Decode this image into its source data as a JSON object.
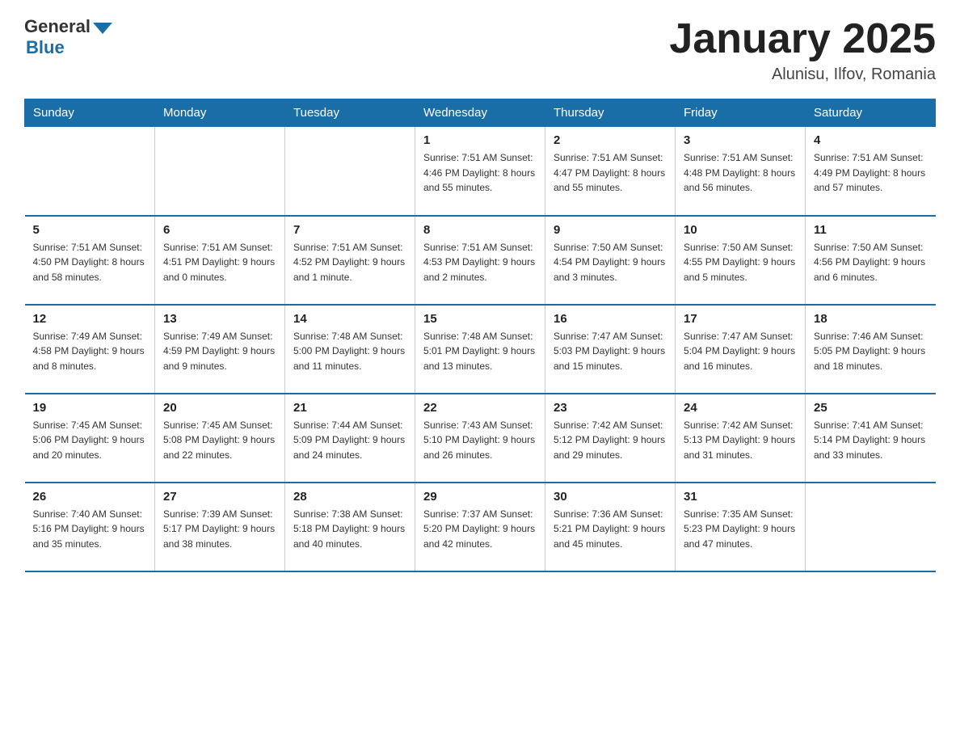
{
  "header": {
    "logo_general": "General",
    "logo_blue": "Blue",
    "main_title": "January 2025",
    "subtitle": "Alunisu, Ilfov, Romania"
  },
  "days_of_week": [
    "Sunday",
    "Monday",
    "Tuesday",
    "Wednesday",
    "Thursday",
    "Friday",
    "Saturday"
  ],
  "weeks": [
    [
      {
        "day": "",
        "info": ""
      },
      {
        "day": "",
        "info": ""
      },
      {
        "day": "",
        "info": ""
      },
      {
        "day": "1",
        "info": "Sunrise: 7:51 AM\nSunset: 4:46 PM\nDaylight: 8 hours\nand 55 minutes."
      },
      {
        "day": "2",
        "info": "Sunrise: 7:51 AM\nSunset: 4:47 PM\nDaylight: 8 hours\nand 55 minutes."
      },
      {
        "day": "3",
        "info": "Sunrise: 7:51 AM\nSunset: 4:48 PM\nDaylight: 8 hours\nand 56 minutes."
      },
      {
        "day": "4",
        "info": "Sunrise: 7:51 AM\nSunset: 4:49 PM\nDaylight: 8 hours\nand 57 minutes."
      }
    ],
    [
      {
        "day": "5",
        "info": "Sunrise: 7:51 AM\nSunset: 4:50 PM\nDaylight: 8 hours\nand 58 minutes."
      },
      {
        "day": "6",
        "info": "Sunrise: 7:51 AM\nSunset: 4:51 PM\nDaylight: 9 hours\nand 0 minutes."
      },
      {
        "day": "7",
        "info": "Sunrise: 7:51 AM\nSunset: 4:52 PM\nDaylight: 9 hours\nand 1 minute."
      },
      {
        "day": "8",
        "info": "Sunrise: 7:51 AM\nSunset: 4:53 PM\nDaylight: 9 hours\nand 2 minutes."
      },
      {
        "day": "9",
        "info": "Sunrise: 7:50 AM\nSunset: 4:54 PM\nDaylight: 9 hours\nand 3 minutes."
      },
      {
        "day": "10",
        "info": "Sunrise: 7:50 AM\nSunset: 4:55 PM\nDaylight: 9 hours\nand 5 minutes."
      },
      {
        "day": "11",
        "info": "Sunrise: 7:50 AM\nSunset: 4:56 PM\nDaylight: 9 hours\nand 6 minutes."
      }
    ],
    [
      {
        "day": "12",
        "info": "Sunrise: 7:49 AM\nSunset: 4:58 PM\nDaylight: 9 hours\nand 8 minutes."
      },
      {
        "day": "13",
        "info": "Sunrise: 7:49 AM\nSunset: 4:59 PM\nDaylight: 9 hours\nand 9 minutes."
      },
      {
        "day": "14",
        "info": "Sunrise: 7:48 AM\nSunset: 5:00 PM\nDaylight: 9 hours\nand 11 minutes."
      },
      {
        "day": "15",
        "info": "Sunrise: 7:48 AM\nSunset: 5:01 PM\nDaylight: 9 hours\nand 13 minutes."
      },
      {
        "day": "16",
        "info": "Sunrise: 7:47 AM\nSunset: 5:03 PM\nDaylight: 9 hours\nand 15 minutes."
      },
      {
        "day": "17",
        "info": "Sunrise: 7:47 AM\nSunset: 5:04 PM\nDaylight: 9 hours\nand 16 minutes."
      },
      {
        "day": "18",
        "info": "Sunrise: 7:46 AM\nSunset: 5:05 PM\nDaylight: 9 hours\nand 18 minutes."
      }
    ],
    [
      {
        "day": "19",
        "info": "Sunrise: 7:45 AM\nSunset: 5:06 PM\nDaylight: 9 hours\nand 20 minutes."
      },
      {
        "day": "20",
        "info": "Sunrise: 7:45 AM\nSunset: 5:08 PM\nDaylight: 9 hours\nand 22 minutes."
      },
      {
        "day": "21",
        "info": "Sunrise: 7:44 AM\nSunset: 5:09 PM\nDaylight: 9 hours\nand 24 minutes."
      },
      {
        "day": "22",
        "info": "Sunrise: 7:43 AM\nSunset: 5:10 PM\nDaylight: 9 hours\nand 26 minutes."
      },
      {
        "day": "23",
        "info": "Sunrise: 7:42 AM\nSunset: 5:12 PM\nDaylight: 9 hours\nand 29 minutes."
      },
      {
        "day": "24",
        "info": "Sunrise: 7:42 AM\nSunset: 5:13 PM\nDaylight: 9 hours\nand 31 minutes."
      },
      {
        "day": "25",
        "info": "Sunrise: 7:41 AM\nSunset: 5:14 PM\nDaylight: 9 hours\nand 33 minutes."
      }
    ],
    [
      {
        "day": "26",
        "info": "Sunrise: 7:40 AM\nSunset: 5:16 PM\nDaylight: 9 hours\nand 35 minutes."
      },
      {
        "day": "27",
        "info": "Sunrise: 7:39 AM\nSunset: 5:17 PM\nDaylight: 9 hours\nand 38 minutes."
      },
      {
        "day": "28",
        "info": "Sunrise: 7:38 AM\nSunset: 5:18 PM\nDaylight: 9 hours\nand 40 minutes."
      },
      {
        "day": "29",
        "info": "Sunrise: 7:37 AM\nSunset: 5:20 PM\nDaylight: 9 hours\nand 42 minutes."
      },
      {
        "day": "30",
        "info": "Sunrise: 7:36 AM\nSunset: 5:21 PM\nDaylight: 9 hours\nand 45 minutes."
      },
      {
        "day": "31",
        "info": "Sunrise: 7:35 AM\nSunset: 5:23 PM\nDaylight: 9 hours\nand 47 minutes."
      },
      {
        "day": "",
        "info": ""
      }
    ]
  ]
}
